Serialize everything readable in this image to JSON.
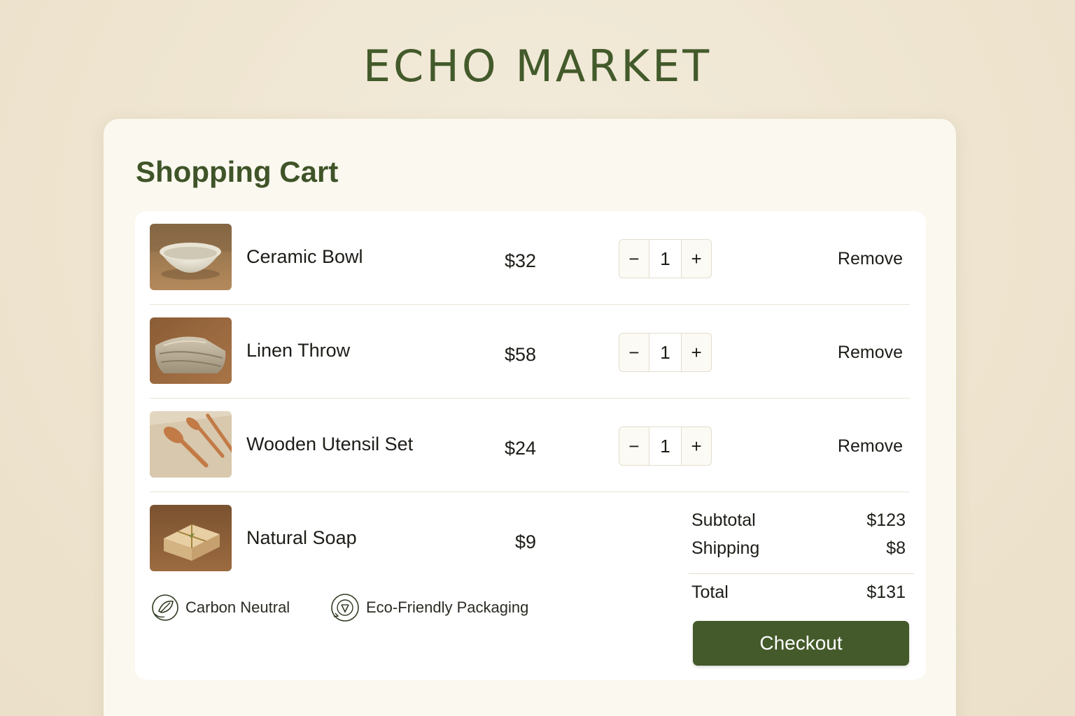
{
  "brand": {
    "title": "ECHO MARKET"
  },
  "cart": {
    "heading": "Shopping Cart",
    "items": [
      {
        "name": "Ceramic Bowl",
        "price": "$32",
        "qty": "1",
        "remove_label": "Remove",
        "image": "ceramic-bowl-photo"
      },
      {
        "name": "Linen Throw",
        "price": "$58",
        "qty": "1",
        "remove_label": "Remove",
        "image": "linen-throw-photo"
      },
      {
        "name": "Wooden Utensil Set",
        "price": "$24",
        "qty": "1",
        "remove_label": "Remove",
        "image": "wooden-utensils-photo"
      },
      {
        "name": "Natural Soap",
        "price": "$9",
        "image": "natural-soap-photo"
      }
    ],
    "stepper": {
      "minus": "−",
      "plus": "+"
    }
  },
  "badges": [
    {
      "label": "Carbon Neutral",
      "icon": "leaf-globe-icon"
    },
    {
      "label": "Eco-Friendly Packaging",
      "icon": "recycle-icon"
    }
  ],
  "summary": {
    "subtotal_label": "Subtotal",
    "subtotal_value": "$123",
    "shipping_label": "Shipping",
    "shipping_value": "$8",
    "total_label": "Total",
    "total_value": "$131"
  },
  "checkout": {
    "label": "Checkout"
  },
  "colors": {
    "accent": "#445a2a",
    "heading": "#3f5428",
    "background": "#efe6d3",
    "card": "#fbf8ef"
  }
}
